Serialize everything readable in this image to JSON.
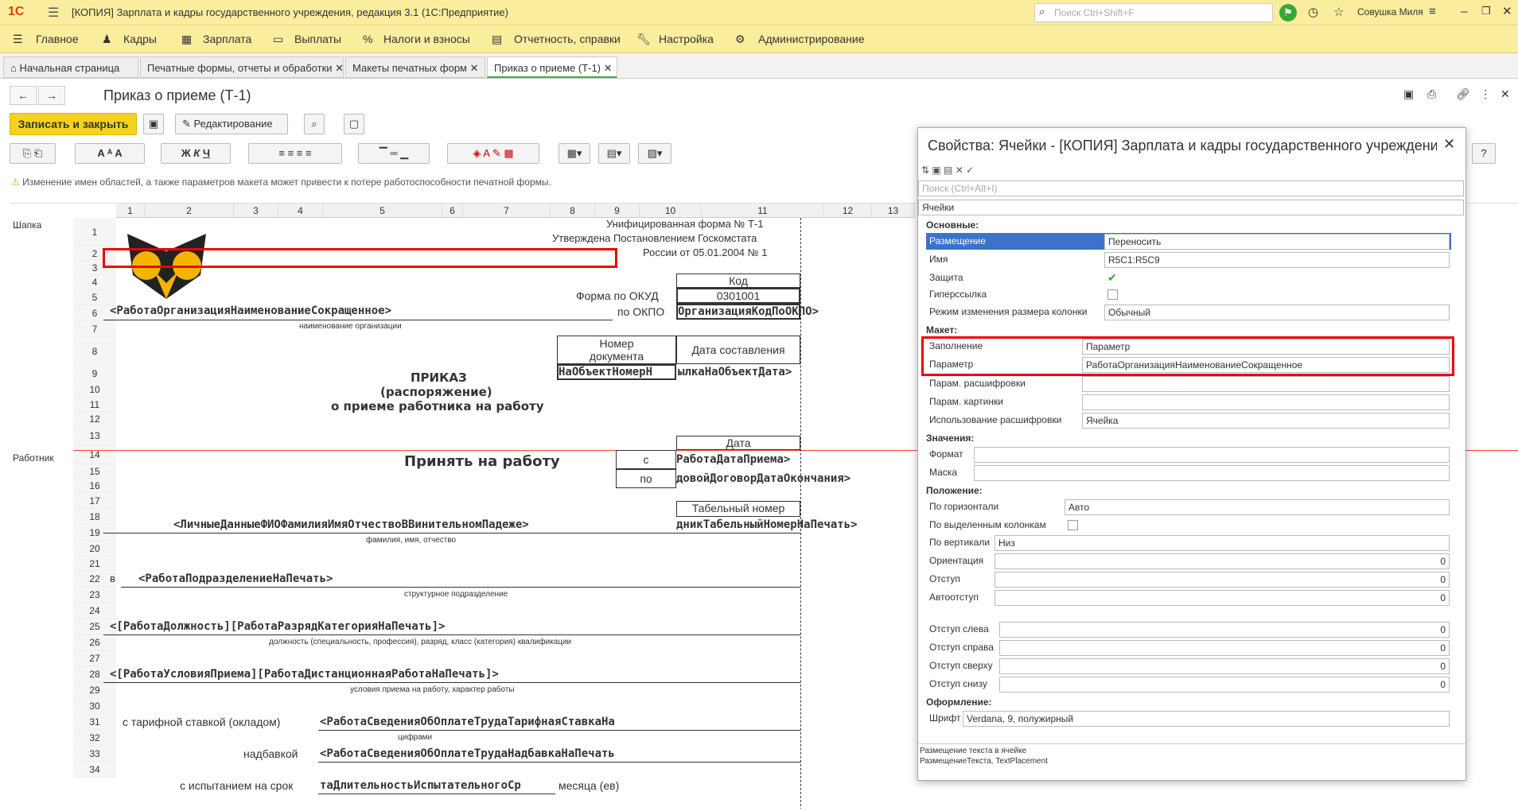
{
  "app": {
    "title": "[КОПИЯ] Зарплата и кадры государственного учреждения, редакция 3.1  (1С:Предприятие)",
    "search_placeholder": "Поиск Ctrl+Shift+F",
    "user": "Совушка Миля",
    "logo": "1С"
  },
  "menu": [
    "Главное",
    "Кадры",
    "Зарплата",
    "Выплаты",
    "Налоги и взносы",
    "Отчетность, справки",
    "Настройка",
    "Администрирование"
  ],
  "tabs": [
    "Начальная страница",
    "Печатные формы, отчеты и обработки",
    "Макеты печатных форм",
    "Приказ о приеме (Т-1)"
  ],
  "doc": {
    "title": "Приказ о приеме (Т-1)",
    "save_close": "Записать и закрыть",
    "edit": "Редактирование",
    "warning": "Изменение имен областей, а также параметров макета может привести к потере работоспособности печатной формы."
  },
  "grid": {
    "cols": [
      "1",
      "2",
      "3",
      "4",
      "5",
      "6",
      "7",
      "8",
      "9",
      "10",
      "11",
      "12",
      "13"
    ],
    "rows": [
      "1",
      "2",
      "3",
      "4",
      "5",
      "6",
      "7",
      "8",
      "9",
      "10",
      "11",
      "12",
      "13",
      "14",
      "15",
      "16",
      "17",
      "18",
      "19",
      "20",
      "21",
      "22",
      "23",
      "24",
      "25",
      "26",
      "27",
      "28",
      "29",
      "30",
      "31",
      "32",
      "33",
      "34"
    ],
    "areas": [
      "Шапка",
      "Работник"
    ]
  },
  "content": {
    "form1": "Унифицированная форма № Т-1",
    "form2": "Утверждена Постановлением Госкомстата",
    "form3": "России от 05.01.2004 № 1",
    "kod": "Код",
    "okud_lbl": "Форма по ОКУД",
    "okud": "0301001",
    "okpo_lbl": "по ОКПО",
    "okpo": "ОрганизацияКодПоОКПО>",
    "org": "<РаботаОрганизацияНаименованиеСокращенное>",
    "org_cap": "наименование организации",
    "nomer": "Номер",
    "dokumenta": "документа",
    "data_sost": "Дата составления",
    "row9a": "НаОбъектНомерН",
    "row9b": "ылкаНаОбъектДата>",
    "prikaz": "ПРИКАЗ",
    "rasp": "(распоряжение)",
    "opriem": "о приеме работника на работу",
    "data": "Дата",
    "prinyat": "Принять на работу",
    "s": "с",
    "po": "по",
    "datapriema": "РаботаДатаПриема>",
    "dataok": "довойДоговорДатаОкончания>",
    "tabnom": "Табельный номер",
    "fio": "<ЛичныеДанныеФИОФамилияИмяОтчествоВВинительномПадеже>",
    "tabnom_val": "дникТабельныйНомерНаПечать>",
    "fio_cap": "фамилия, имя, отчество",
    "v": "в",
    "podr": "<РаботаПодразделениеНаПечать>",
    "podr_cap": "структурное подразделение",
    "dolzh": "<[РаботаДолжность][РаботаРазрядКатегорияНаПечать]>",
    "dolzh_cap": "должность (специальность, профессия), разряд, класс (категория) квалификации",
    "usl": "<[РаботаУсловияПриема][РаботаДистанционнаяРаботаНаПечать]>",
    "usl_cap": "условия приема на работу, характер работы",
    "tarif_lbl": "с тарифной ставкой (окладом)",
    "tarif": "<РаботаСведенияОбОплатеТрудаТарифнаяСтавкаНа",
    "cifr": "цифрами",
    "nadb_lbl": "надбавкой",
    "nadb": "<РаботаСведенияОбОплатеТрудаНадбавкаНаПечать",
    "isp_lbl": "с испытанием на срок",
    "isp": "таДлительностьИспытательногоСр",
    "mes": "месяца (ев)"
  },
  "panel": {
    "title": "Свойства: Ячейки - [КОПИЯ] Зарплата и кадры государственного учреждения, редакция 3.1",
    "search": "Поиск (Ctrl+Alt+I)",
    "scope": "Ячейки",
    "sec_main": "Основные:",
    "sec_layout": "Макет:",
    "sec_values": "Значения:",
    "sec_pos": "Положение:",
    "sec_style": "Оформление:",
    "props": {
      "razm_l": "Размещение",
      "razm": "Переносить",
      "imya_l": "Имя",
      "imya": "R5C1:R5C9",
      "zash_l": "Защита",
      "giper_l": "Гиперссылка",
      "rezhim_l": "Режим изменения размера колонки",
      "rezhim": "Обычный",
      "zap_l": "Заполнение",
      "zap": "Параметр",
      "param_l": "Параметр",
      "param": "РаботаОрганизацияНаименованиеСокращенное",
      "rasshif_l": "Парам. расшифровки",
      "kart_l": "Парам. картинки",
      "isp_l": "Использование расшифровки",
      "isp": "Ячейка",
      "format_l": "Формат",
      "maska_l": "Маска",
      "gor_l": "По горизонтали",
      "gor": "Авто",
      "vydel_l": "По выделенным колонкам",
      "vert_l": "По вертикали",
      "vert": "Низ",
      "orient_l": "Ориентация",
      "orient": "0",
      "otst_l": "Отступ",
      "otst": "0",
      "avto_l": "Автоотступ",
      "avto": "0",
      "sleva_l": "Отступ слева",
      "sleva": "0",
      "sprava_l": "Отступ справа",
      "sprava": "0",
      "sverhu_l": "Отступ сверху",
      "sverhu": "0",
      "snizu_l": "Отступ снизу",
      "snizu": "0",
      "shrift_l": "Шрифт",
      "shrift": "Verdana, 9, полужирный"
    },
    "hint1": "Размещение текста в ячейке",
    "hint2": "РазмещениеТекста, TextPlacement"
  }
}
